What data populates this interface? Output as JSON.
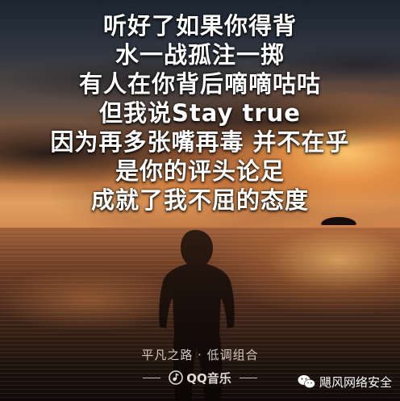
{
  "lyrics": [
    "听好了如果你得背",
    "水一战孤注一掷",
    "有人在你背后嘀嘀咕咕",
    "但我说Stay true",
    "因为再多张嘴再毒 并不在乎",
    "是你的评头论足",
    "成就了我不屈的态度"
  ],
  "song": {
    "title": "平凡之路 · 低调组合"
  },
  "brand": {
    "name": "QQ音乐",
    "icon": "qq-music-icon"
  },
  "watermark": {
    "account": "飓风网络安全",
    "icon": "wechat-icon"
  },
  "colors": {
    "text": "#ffffff",
    "sky_glow": "#e0a060",
    "sea_dark": "#1c120d"
  }
}
